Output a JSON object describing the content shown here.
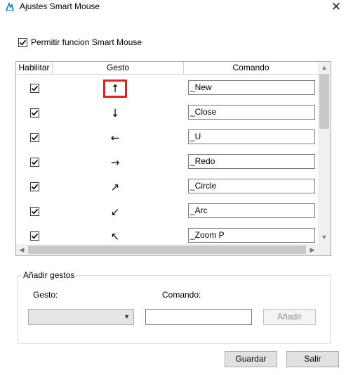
{
  "window": {
    "title": "Ajustes Smart Mouse",
    "close_glyph": "✕"
  },
  "enable": {
    "label": "Permitir funcion Smart Mouse",
    "checked": true
  },
  "grid": {
    "headers": [
      "Habilitar",
      "Gesto",
      "Comando"
    ],
    "rows": [
      {
        "enabled": true,
        "gesture": "↑",
        "command": "_New"
      },
      {
        "enabled": true,
        "gesture": "↓",
        "command": "_Close"
      },
      {
        "enabled": true,
        "gesture": "←",
        "command": "_U"
      },
      {
        "enabled": true,
        "gesture": "→",
        "command": "_Redo"
      },
      {
        "enabled": true,
        "gesture": "↗",
        "command": "_Circle"
      },
      {
        "enabled": true,
        "gesture": "↙",
        "command": "_Arc"
      },
      {
        "enabled": true,
        "gesture": "↖",
        "command": "_Zoom P"
      }
    ],
    "highlighted_gesture_row": 0
  },
  "add_group": {
    "title": "Añadir gestos",
    "gesture_label": "Gesto:",
    "command_label": "Comando:",
    "gesture_value": "",
    "command_value": "",
    "add_button": "Añadir"
  },
  "footer": {
    "save": "Guardar",
    "exit": "Salir"
  },
  "colors": {
    "highlight": "#e02020",
    "accent": "#0078d7"
  }
}
